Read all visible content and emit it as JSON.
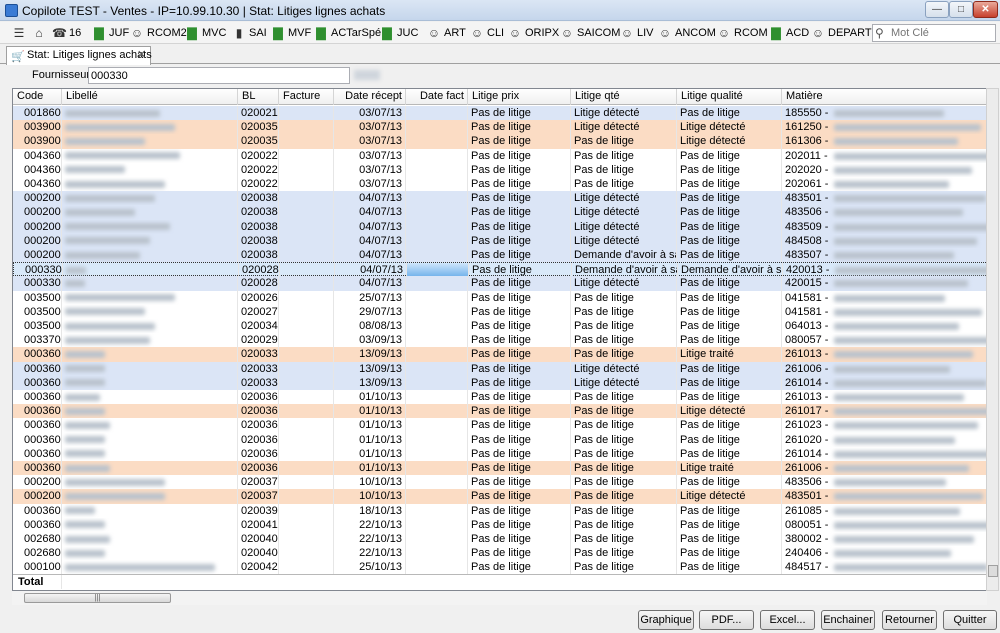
{
  "window": {
    "title": "Copilote TEST - Ventes -        IP=10.99.10.30 | Stat: Litiges lignes achats"
  },
  "toolbar": {
    "items": [
      {
        "label": "",
        "icon": "menu-icon"
      },
      {
        "label": "",
        "icon": "home-icon"
      },
      {
        "label": "16",
        "icon": "phone-icon"
      },
      {
        "label": "JUF",
        "icon": "bar-chart-icon"
      },
      {
        "label": "RCOM2",
        "icon": "person-icon"
      },
      {
        "label": "MVC",
        "icon": "bar-chart-icon"
      },
      {
        "label": "SAI",
        "icon": "truck-icon"
      },
      {
        "label": "MVF",
        "icon": "bar-chart-icon"
      },
      {
        "label": "ACTarSpé",
        "icon": "bar-chart-icon"
      },
      {
        "label": "JUC",
        "icon": "bar-chart-icon"
      },
      {
        "label": "ART",
        "icon": "person-icon"
      },
      {
        "label": "CLI",
        "icon": "person-icon"
      },
      {
        "label": "ORIPX",
        "icon": "person-icon"
      },
      {
        "label": "SAICOM",
        "icon": "person-icon"
      },
      {
        "label": "LIV",
        "icon": "person-icon"
      },
      {
        "label": "ANCOM",
        "icon": "person-icon"
      },
      {
        "label": "RCOM",
        "icon": "person-icon"
      },
      {
        "label": "ACD",
        "icon": "bar-chart-icon"
      },
      {
        "label": "DEPART",
        "icon": "person-icon"
      }
    ],
    "search_placeholder": "Mot Clé"
  },
  "tab": {
    "label": "Stat: Litiges lignes achats"
  },
  "filter": {
    "label": "Fournisseur:",
    "value": "000330"
  },
  "table": {
    "columns": [
      "Code",
      "Libellé",
      "BL",
      "Facture",
      "Date récept",
      "Date fact",
      "Litige prix",
      "Litige qté",
      "Litige qualité",
      "Matière"
    ],
    "rows": [
      {
        "code": "001860",
        "bl": "020021",
        "date": "03/07/13",
        "prix": "Pas de litige",
        "qte": "Litige détecté",
        "qual": "Pas de litige",
        "mat": "185550 -",
        "bg": "blue"
      },
      {
        "code": "003900",
        "bl": "020035",
        "date": "03/07/13",
        "prix": "Pas de litige",
        "qte": "Litige détecté",
        "qual": "Litige détecté",
        "mat": "161250 -",
        "bg": "orange"
      },
      {
        "code": "003900",
        "bl": "020035",
        "date": "03/07/13",
        "prix": "Pas de litige",
        "qte": "Pas de litige",
        "qual": "Litige détecté",
        "mat": "161306 -",
        "bg": "orange"
      },
      {
        "code": "004360",
        "bl": "020022",
        "date": "03/07/13",
        "prix": "Pas de litige",
        "qte": "Pas de litige",
        "qual": "Pas de litige",
        "mat": "202011 -",
        "bg": "white"
      },
      {
        "code": "004360",
        "bl": "020022",
        "date": "03/07/13",
        "prix": "Pas de litige",
        "qte": "Pas de litige",
        "qual": "Pas de litige",
        "mat": "202020 -",
        "bg": "white"
      },
      {
        "code": "004360",
        "bl": "020022",
        "date": "03/07/13",
        "prix": "Pas de litige",
        "qte": "Pas de litige",
        "qual": "Pas de litige",
        "mat": "202061 -",
        "bg": "white"
      },
      {
        "code": "000200",
        "bl": "020038",
        "date": "04/07/13",
        "prix": "Pas de litige",
        "qte": "Litige détecté",
        "qual": "Pas de litige",
        "mat": "483501 -",
        "bg": "blue"
      },
      {
        "code": "000200",
        "bl": "020038",
        "date": "04/07/13",
        "prix": "Pas de litige",
        "qte": "Litige détecté",
        "qual": "Pas de litige",
        "mat": "483506 -",
        "bg": "blue"
      },
      {
        "code": "000200",
        "bl": "020038",
        "date": "04/07/13",
        "prix": "Pas de litige",
        "qte": "Litige détecté",
        "qual": "Pas de litige",
        "mat": "483509 -",
        "bg": "blue"
      },
      {
        "code": "000200",
        "bl": "020038",
        "date": "04/07/13",
        "prix": "Pas de litige",
        "qte": "Litige détecté",
        "qual": "Pas de litige",
        "mat": "484508 -",
        "bg": "blue"
      },
      {
        "code": "000200",
        "bl": "020038",
        "date": "04/07/13",
        "prix": "Pas de litige",
        "qte": "Demande d'avoir à saisir",
        "qual": "Pas de litige",
        "mat": "483507 -",
        "bg": "blue"
      },
      {
        "code": "000330",
        "bl": "020028",
        "date": "04/07/13",
        "prix": "Pas de litige",
        "qte": "Demande d'avoir à saisir",
        "qual": "Demande d'avoir à saisir",
        "mat": "420013 -",
        "bg": "selected"
      },
      {
        "code": "000330",
        "bl": "020028",
        "date": "04/07/13",
        "prix": "Pas de litige",
        "qte": "Litige détecté",
        "qual": "Pas de litige",
        "mat": "420015 -",
        "bg": "blue"
      },
      {
        "code": "003500",
        "bl": "020026",
        "date": "25/07/13",
        "prix": "Pas de litige",
        "qte": "Pas de litige",
        "qual": "Pas de litige",
        "mat": "041581 -",
        "bg": "white"
      },
      {
        "code": "003500",
        "bl": "020027",
        "date": "29/07/13",
        "prix": "Pas de litige",
        "qte": "Pas de litige",
        "qual": "Pas de litige",
        "mat": "041581 -",
        "bg": "white"
      },
      {
        "code": "003500",
        "bl": "020034",
        "date": "08/08/13",
        "prix": "Pas de litige",
        "qte": "Pas de litige",
        "qual": "Pas de litige",
        "mat": "064013 -",
        "bg": "white"
      },
      {
        "code": "003370",
        "bl": "020029",
        "date": "03/09/13",
        "prix": "Pas de litige",
        "qte": "Pas de litige",
        "qual": "Pas de litige",
        "mat": "080057 -",
        "bg": "white"
      },
      {
        "code": "000360",
        "bl": "020033",
        "date": "13/09/13",
        "prix": "Pas de litige",
        "qte": "Pas de litige",
        "qual": "Litige traité",
        "mat": "261013 -",
        "bg": "orange"
      },
      {
        "code": "000360",
        "bl": "020033",
        "date": "13/09/13",
        "prix": "Pas de litige",
        "qte": "Litige détecté",
        "qual": "Pas de litige",
        "mat": "261006 -",
        "bg": "blue"
      },
      {
        "code": "000360",
        "bl": "020033",
        "date": "13/09/13",
        "prix": "Pas de litige",
        "qte": "Litige détecté",
        "qual": "Pas de litige",
        "mat": "261014 -",
        "bg": "blue"
      },
      {
        "code": "000360",
        "bl": "020036",
        "date": "01/10/13",
        "prix": "Pas de litige",
        "qte": "Pas de litige",
        "qual": "Pas de litige",
        "mat": "261013 -",
        "bg": "white"
      },
      {
        "code": "000360",
        "bl": "020036",
        "date": "01/10/13",
        "prix": "Pas de litige",
        "qte": "Pas de litige",
        "qual": "Litige détecté",
        "mat": "261017 -",
        "bg": "orange"
      },
      {
        "code": "000360",
        "bl": "020036",
        "date": "01/10/13",
        "prix": "Pas de litige",
        "qte": "Pas de litige",
        "qual": "Pas de litige",
        "mat": "261023 -",
        "bg": "white"
      },
      {
        "code": "000360",
        "bl": "020036",
        "date": "01/10/13",
        "prix": "Pas de litige",
        "qte": "Pas de litige",
        "qual": "Pas de litige",
        "mat": "261020 -",
        "bg": "white"
      },
      {
        "code": "000360",
        "bl": "020036",
        "date": "01/10/13",
        "prix": "Pas de litige",
        "qte": "Pas de litige",
        "qual": "Pas de litige",
        "mat": "261014 -",
        "bg": "white"
      },
      {
        "code": "000360",
        "bl": "020036",
        "date": "01/10/13",
        "prix": "Pas de litige",
        "qte": "Pas de litige",
        "qual": "Litige traité",
        "mat": "261006 -",
        "bg": "orange"
      },
      {
        "code": "000200",
        "bl": "020037",
        "date": "10/10/13",
        "prix": "Pas de litige",
        "qte": "Pas de litige",
        "qual": "Pas de litige",
        "mat": "483506 -",
        "bg": "white"
      },
      {
        "code": "000200",
        "bl": "020037",
        "date": "10/10/13",
        "prix": "Pas de litige",
        "qte": "Pas de litige",
        "qual": "Litige détecté",
        "mat": "483501 -",
        "bg": "orange"
      },
      {
        "code": "000360",
        "bl": "020039",
        "date": "18/10/13",
        "prix": "Pas de litige",
        "qte": "Pas de litige",
        "qual": "Pas de litige",
        "mat": "261085 -",
        "bg": "white"
      },
      {
        "code": "000360",
        "bl": "020041",
        "date": "22/10/13",
        "prix": "Pas de litige",
        "qte": "Pas de litige",
        "qual": "Pas de litige",
        "mat": "080051 -",
        "bg": "white"
      },
      {
        "code": "002680",
        "bl": "020040",
        "date": "22/10/13",
        "prix": "Pas de litige",
        "qte": "Pas de litige",
        "qual": "Pas de litige",
        "mat": "380002 -",
        "bg": "white"
      },
      {
        "code": "002680",
        "bl": "020040",
        "date": "22/10/13",
        "prix": "Pas de litige",
        "qte": "Pas de litige",
        "qual": "Pas de litige",
        "mat": "240406 -",
        "bg": "white"
      },
      {
        "code": "000100",
        "bl": "020042",
        "date": "25/10/13",
        "prix": "Pas de litige",
        "qte": "Pas de litige",
        "qual": "Pas de litige",
        "mat": "484517 -",
        "bg": "white"
      }
    ],
    "total_label": "Total"
  },
  "buttons": [
    "Graphique",
    "PDF...",
    "Excel...",
    "Enchainer",
    "Retourner",
    "Quitter"
  ],
  "colors": {
    "blue": "#dbe5f6",
    "orange": "#fbdcc4",
    "white": "#ffffff",
    "selected": "#d9e9f9"
  }
}
